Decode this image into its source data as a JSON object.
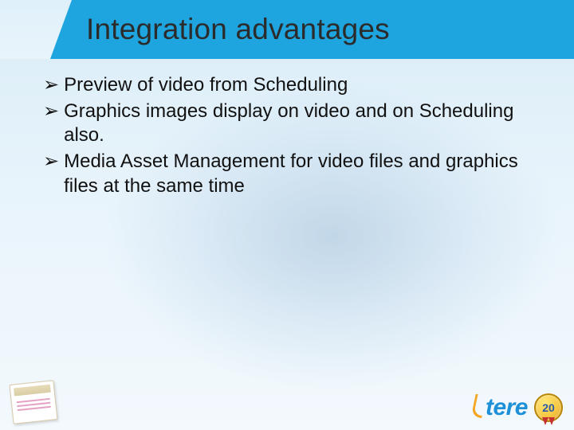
{
  "title": "Integration advantages",
  "bullets": [
    "Preview of video from Scheduling",
    "Graphics images display on video and on Scheduling also.",
    "Media Asset Management for video files and graphics files at the same time"
  ],
  "bullet_marker": "➢",
  "brand": {
    "name": "tere",
    "badge_number": "20"
  }
}
